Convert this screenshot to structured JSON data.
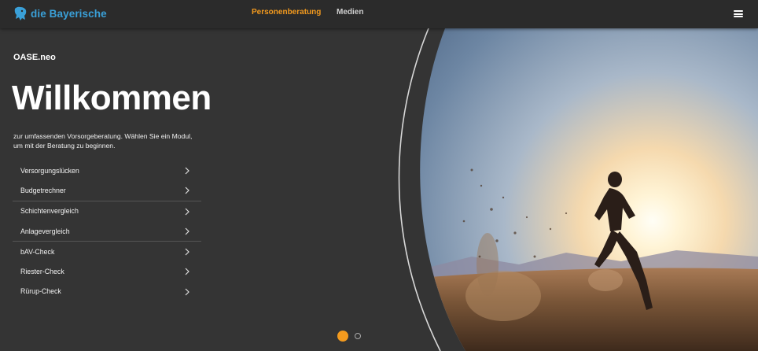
{
  "header": {
    "brand": "die Bayerische",
    "nav": [
      "Personenberatung",
      "Medien"
    ],
    "active_color": "#f39a1e",
    "brand_color": "#3aa0d8"
  },
  "hero": {
    "app_name": "OASE.neo",
    "title": "Willkommen",
    "subtitle_line1": "zur umfassenden Vorsorgeberatung. Wählen Sie ein Modul,",
    "subtitle_line2": "um mit der Beratung zu beginnen."
  },
  "modules": [
    "Versorgungslücken",
    "Budgetrechner",
    "Schichtenvergleich",
    "Anlagevergleich",
    "bAV-Check",
    "Riester-Check",
    "Rürup-Check"
  ],
  "carousel": {
    "active_index": 0,
    "total": 2
  }
}
